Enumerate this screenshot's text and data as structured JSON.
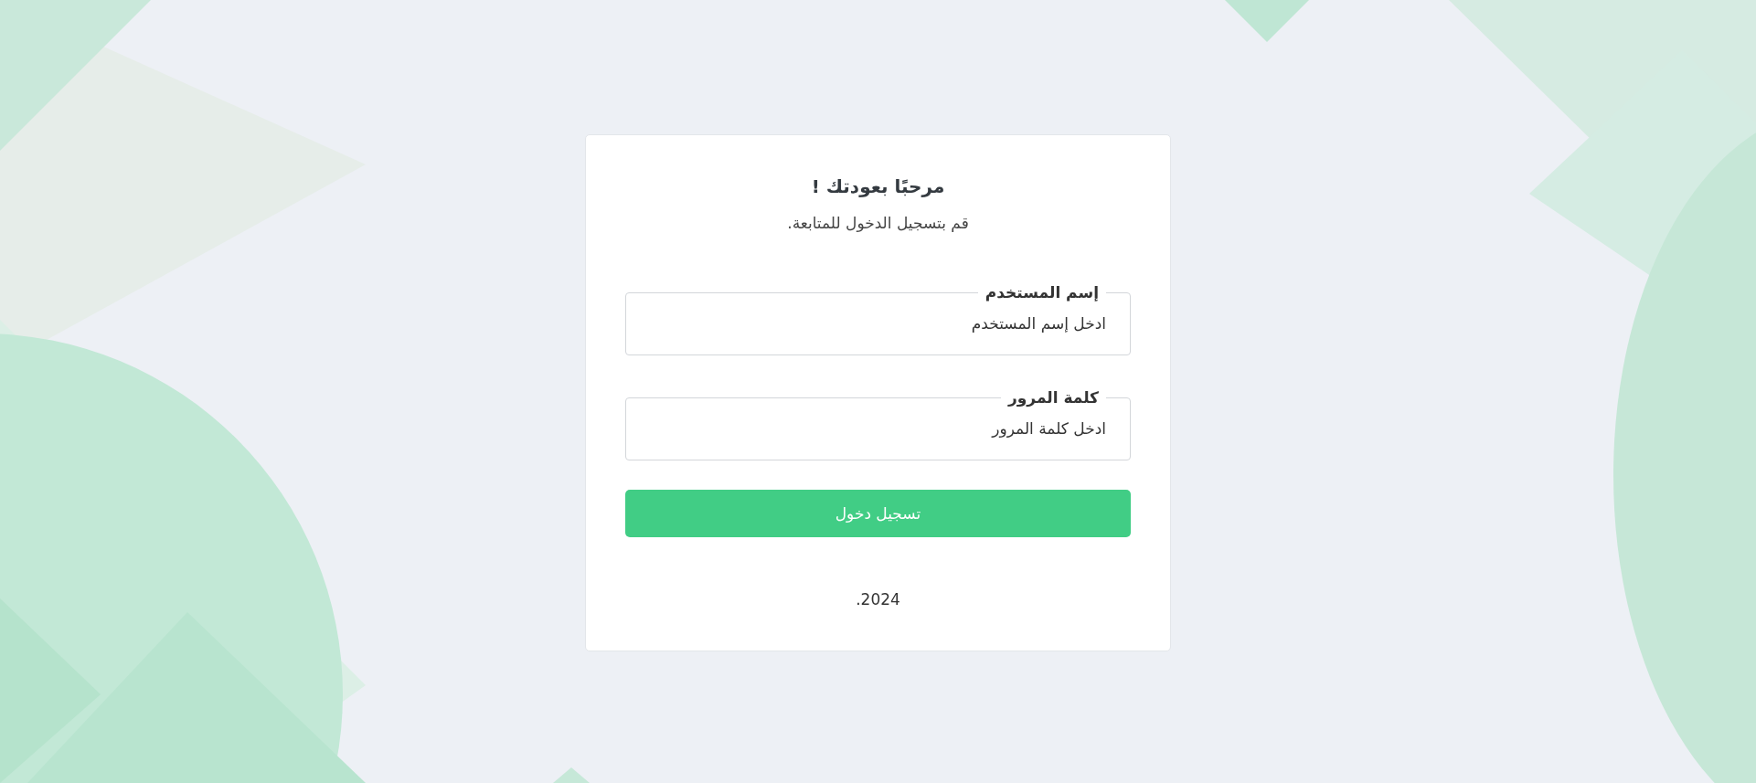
{
  "card": {
    "title": "مرحبًا بعودتك !",
    "subtitle": "قم بتسجيل الدخول للمتابعة.",
    "fields": [
      {
        "label": "إسم المستخدم",
        "placeholder": "ادخل إسم المستخدم"
      },
      {
        "label": "كلمة المرور",
        "placeholder": "ادخل كلمة المرور"
      }
    ],
    "submit_button": "تسجيل دخول",
    "footer": "2024."
  }
}
